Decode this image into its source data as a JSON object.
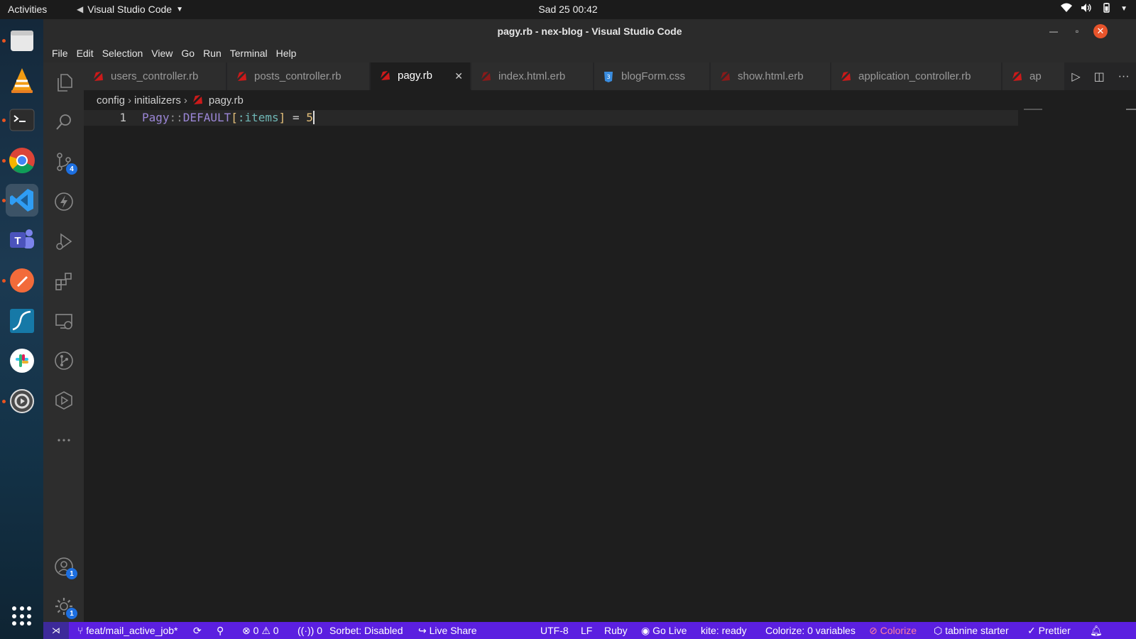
{
  "topbar": {
    "activities": "Activities",
    "app_name": "Visual Studio Code",
    "clock": "Sad 25  00:42"
  },
  "window": {
    "title": "pagy.rb - nex-blog - Visual Studio Code"
  },
  "menu": [
    "File",
    "Edit",
    "Selection",
    "View",
    "Go",
    "Run",
    "Terminal",
    "Help"
  ],
  "activity_badges": {
    "source_control": "4",
    "accounts": "1",
    "settings": "1"
  },
  "tabs": [
    {
      "label": "users_controller.rb",
      "icon": "ruby-icon"
    },
    {
      "label": "posts_controller.rb",
      "icon": "ruby-icon"
    },
    {
      "label": "pagy.rb",
      "icon": "ruby-icon",
      "active": true
    },
    {
      "label": "index.html.erb",
      "icon": "erb-icon"
    },
    {
      "label": "blogForm.css",
      "icon": "css-icon"
    },
    {
      "label": "show.html.erb",
      "icon": "erb-icon"
    },
    {
      "label": "application_controller.rb",
      "icon": "ruby-icon"
    },
    {
      "label": "ap",
      "icon": "ruby-icon"
    }
  ],
  "breadcrumb": [
    "config",
    "initializers",
    "pagy.rb"
  ],
  "editor": {
    "line_number": "1",
    "tokens": {
      "t1": "Pagy",
      "t2": "::",
      "t3": "DEFAULT",
      "t4": "[",
      "t5": ":items",
      "t6": "]",
      "t7": " = ",
      "t8": "5"
    }
  },
  "statusbar": {
    "branch": "feat/mail_active_job*",
    "errors": "0",
    "warnings": "0",
    "ports": "0",
    "sorbet": "Sorbet: Disabled",
    "live_share": "Live Share",
    "encoding": "UTF-8",
    "eol": "LF",
    "language": "Ruby",
    "go_live": "Go Live",
    "kite": "kite: ready",
    "colorize_vars": "Colorize: 0 variables",
    "colorize": "Colorize",
    "tabnine": "tabnine starter",
    "prettier": "Prettier"
  },
  "colors": {
    "statusbar": "#5b1fe0",
    "ruby": "#cc1a1a",
    "css": "#3a8cde"
  }
}
